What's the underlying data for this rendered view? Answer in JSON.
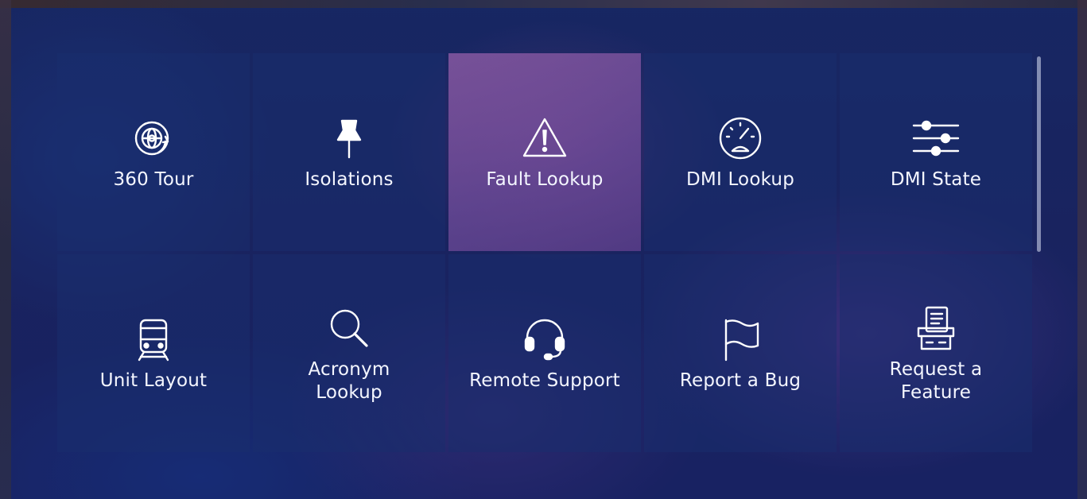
{
  "menu": {
    "tiles": [
      {
        "label": "360 Tour",
        "icon": "globe-360-icon"
      },
      {
        "label": "Isolations",
        "icon": "pushpin-icon"
      },
      {
        "label": "Fault Lookup",
        "icon": "warning-triangle-icon",
        "selected": true
      },
      {
        "label": "DMI Lookup",
        "icon": "gauge-icon"
      },
      {
        "label": "DMI State",
        "icon": "sliders-icon"
      },
      {
        "label": "Unit Layout",
        "icon": "train-icon"
      },
      {
        "label": "Acronym\nLookup",
        "icon": "search-icon"
      },
      {
        "label": "Remote Support",
        "icon": "headset-icon"
      },
      {
        "label": "Report a Bug",
        "icon": "flag-icon"
      },
      {
        "label": "Request a\nFeature",
        "icon": "feature-box-icon"
      }
    ]
  },
  "colors": {
    "background": "#1c2460",
    "tile": "#1d2d6e",
    "tile_selected": "#8a5aa6",
    "text": "#ffffff"
  }
}
